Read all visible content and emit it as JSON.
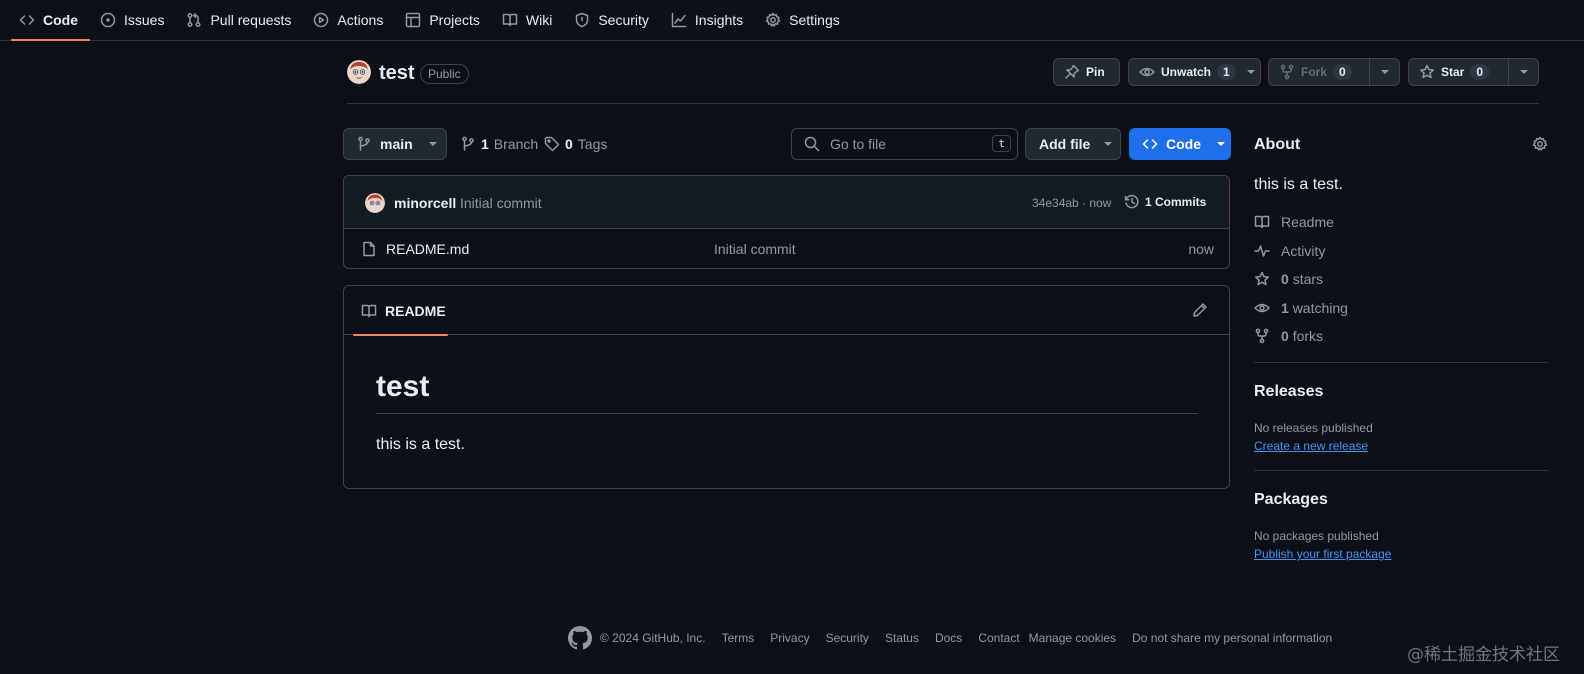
{
  "nav": {
    "tabs": [
      {
        "label": "Code",
        "icon": "code-icon",
        "active": true
      },
      {
        "label": "Issues",
        "icon": "issue-icon"
      },
      {
        "label": "Pull requests",
        "icon": "pull-request-icon"
      },
      {
        "label": "Actions",
        "icon": "play-icon"
      },
      {
        "label": "Projects",
        "icon": "table-icon"
      },
      {
        "label": "Wiki",
        "icon": "book-icon"
      },
      {
        "label": "Security",
        "icon": "shield-icon"
      },
      {
        "label": "Insights",
        "icon": "graph-icon"
      },
      {
        "label": "Settings",
        "icon": "gear-icon"
      }
    ]
  },
  "repo": {
    "name": "test",
    "visibility": "Public",
    "actions": {
      "pin": "Pin",
      "unwatch": "Unwatch",
      "watch_count": "1",
      "fork": "Fork",
      "fork_count": "0",
      "star": "Star",
      "star_count": "0"
    }
  },
  "toolbar": {
    "branch": "main",
    "branch_count": "1",
    "branch_label": "Branch",
    "tag_count": "0",
    "tag_label": "Tags",
    "search_placeholder": "Go to file",
    "search_shortcut": "t",
    "add_file": "Add file",
    "code": "Code"
  },
  "latest_commit": {
    "author": "minorcell",
    "message": "Initial commit",
    "sha_time": "34e34ab · now",
    "commits": "1 Commits"
  },
  "files": [
    {
      "name": "README.md",
      "message": "Initial commit",
      "time": "now"
    }
  ],
  "readme": {
    "tab": "README",
    "heading": "test",
    "body": "this is a test."
  },
  "about": {
    "title": "About",
    "description": "this is a test.",
    "readme": "Readme",
    "activity": "Activity",
    "stars_count": "0",
    "stars_label": "stars",
    "watching_count": "1",
    "watching_label": "watching",
    "forks_count": "0",
    "forks_label": "forks"
  },
  "releases": {
    "title": "Releases",
    "empty": "No releases published",
    "link": "Create a new release"
  },
  "packages": {
    "title": "Packages",
    "empty": "No packages published",
    "link": "Publish your first package"
  },
  "footer": {
    "copyright": "© 2024 GitHub, Inc.",
    "links": [
      "Terms",
      "Privacy",
      "Security",
      "Status",
      "Docs",
      "Contact",
      "Manage cookies",
      "Do not share my personal information"
    ]
  },
  "watermark": "@稀土掘金技术社区",
  "colors": {
    "accent": "#1f6feb",
    "tab_underline": "#f78166",
    "link": "#4493f8",
    "background": "#0d1117"
  }
}
